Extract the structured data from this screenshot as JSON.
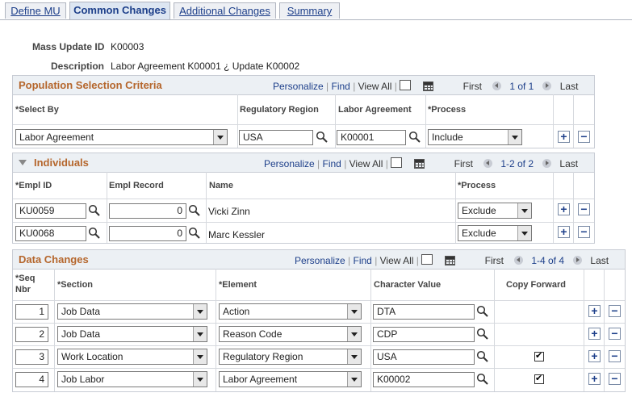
{
  "tabs": [
    {
      "label": "Define MU"
    },
    {
      "label": "Common Changes"
    },
    {
      "label": "Additional Changes"
    },
    {
      "label": "Summary"
    }
  ],
  "header": {
    "mass_update_id_label": "Mass Update ID",
    "mass_update_id": "K00003",
    "description_label": "Description",
    "description": "Labor Agreement K00001 ¿ Update K00002"
  },
  "nav": {
    "personalize": "Personalize",
    "find": "Find",
    "view_all": "View All",
    "first": "First",
    "last": "Last"
  },
  "population": {
    "title": "Population Selection Criteria",
    "range": "1 of 1",
    "cols": [
      "*Select By",
      "Regulatory Region",
      "Labor Agreement",
      "*Process"
    ],
    "row": {
      "select_by": "Labor Agreement",
      "region": "USA",
      "agreement": "K00001",
      "process": "Include"
    }
  },
  "individuals": {
    "title": "Individuals",
    "range": "1-2 of 2",
    "cols": [
      "*Empl ID",
      "Empl Record",
      "Name",
      "*Process"
    ],
    "rows": [
      {
        "empl_id": "KU0059",
        "empl_record": "0",
        "name": "Vicki Zinn",
        "process": "Exclude"
      },
      {
        "empl_id": "KU0068",
        "empl_record": "0",
        "name": "Marc Kessler",
        "process": "Exclude"
      }
    ]
  },
  "data_changes": {
    "title": "Data Changes",
    "range": "1-4 of 4",
    "cols": {
      "seq_line1": "*Seq",
      "seq_line2": "Nbr",
      "section": "*Section",
      "element": "*Element",
      "char_value": "Character Value",
      "copy_forward": "Copy Forward"
    },
    "rows": [
      {
        "seq": "1",
        "section": "Job Data",
        "element": "Action",
        "char_value": "DTA",
        "copy_forward": false
      },
      {
        "seq": "2",
        "section": "Job Data",
        "element": "Reason Code",
        "char_value": "CDP",
        "copy_forward": false
      },
      {
        "seq": "3",
        "section": "Work Location",
        "element": "Regulatory Region",
        "char_value": "USA",
        "copy_forward": true
      },
      {
        "seq": "4",
        "section": "Job Labor",
        "element": "Labor Agreement",
        "char_value": "K00002",
        "copy_forward": true
      }
    ]
  },
  "symbols": {
    "add": "+",
    "remove": "−",
    "check": "✔"
  }
}
